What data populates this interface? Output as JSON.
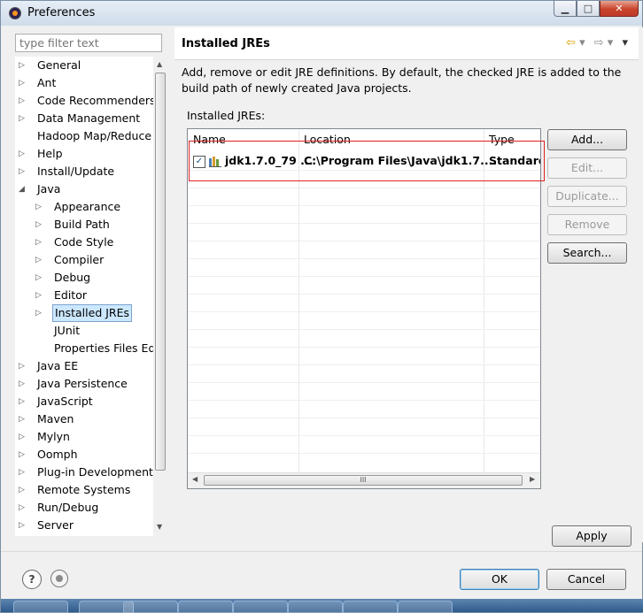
{
  "window": {
    "title": "Preferences",
    "minimize_glyph": "▁",
    "maximize_glyph": "□",
    "close_glyph": "✕"
  },
  "filter": {
    "placeholder": "type filter text"
  },
  "tree": [
    {
      "label": "General",
      "level": 0,
      "expander": "collapsed"
    },
    {
      "label": "Ant",
      "level": 0,
      "expander": "collapsed"
    },
    {
      "label": "Code Recommenders",
      "level": 0,
      "expander": "collapsed"
    },
    {
      "label": "Data Management",
      "level": 0,
      "expander": "collapsed"
    },
    {
      "label": "Hadoop Map/Reduce",
      "level": 0,
      "expander": "none"
    },
    {
      "label": "Help",
      "level": 0,
      "expander": "collapsed"
    },
    {
      "label": "Install/Update",
      "level": 0,
      "expander": "collapsed"
    },
    {
      "label": "Java",
      "level": 0,
      "expander": "expanded"
    },
    {
      "label": "Appearance",
      "level": 1,
      "expander": "collapsed"
    },
    {
      "label": "Build Path",
      "level": 1,
      "expander": "collapsed"
    },
    {
      "label": "Code Style",
      "level": 1,
      "expander": "collapsed"
    },
    {
      "label": "Compiler",
      "level": 1,
      "expander": "collapsed"
    },
    {
      "label": "Debug",
      "level": 1,
      "expander": "collapsed"
    },
    {
      "label": "Editor",
      "level": 1,
      "expander": "collapsed"
    },
    {
      "label": "Installed JREs",
      "level": 1,
      "expander": "collapsed",
      "selected": true
    },
    {
      "label": "JUnit",
      "level": 1,
      "expander": "none"
    },
    {
      "label": "Properties Files Ed",
      "level": 1,
      "expander": "none"
    },
    {
      "label": "Java EE",
      "level": 0,
      "expander": "collapsed"
    },
    {
      "label": "Java Persistence",
      "level": 0,
      "expander": "collapsed"
    },
    {
      "label": "JavaScript",
      "level": 0,
      "expander": "collapsed"
    },
    {
      "label": "Maven",
      "level": 0,
      "expander": "collapsed"
    },
    {
      "label": "Mylyn",
      "level": 0,
      "expander": "collapsed"
    },
    {
      "label": "Oomph",
      "level": 0,
      "expander": "collapsed"
    },
    {
      "label": "Plug-in Development",
      "level": 0,
      "expander": "collapsed"
    },
    {
      "label": "Remote Systems",
      "level": 0,
      "expander": "collapsed"
    },
    {
      "label": "Run/Debug",
      "level": 0,
      "expander": "collapsed"
    },
    {
      "label": "Server",
      "level": 0,
      "expander": "collapsed"
    }
  ],
  "page": {
    "title": "Installed JREs",
    "back_glyph": "⇦",
    "forward_glyph": "⇨",
    "menu_glyph": "▾",
    "description": "Add, remove or edit JRE definitions. By default, the checked JRE is added to the build path of newly created Java projects.",
    "installed_label": "Installed JREs:",
    "columns": [
      "Name",
      "Location",
      "Type"
    ],
    "rows": [
      {
        "checked": true,
        "name": "jdk1.7.0_79 ...",
        "location": "C:\\Program Files\\Java\\jdk1.7....",
        "type": "Standard"
      }
    ],
    "scroll_grip": "III"
  },
  "buttons": {
    "add": "Add...",
    "edit": "Edit...",
    "duplicate": "Duplicate...",
    "remove": "Remove",
    "search": "Search...",
    "apply": "Apply",
    "ok": "OK",
    "cancel": "Cancel",
    "help": "?"
  },
  "colors": {
    "highlight": "#e02020",
    "selection": "#cce8ff",
    "accent": "#3c7fb1"
  }
}
